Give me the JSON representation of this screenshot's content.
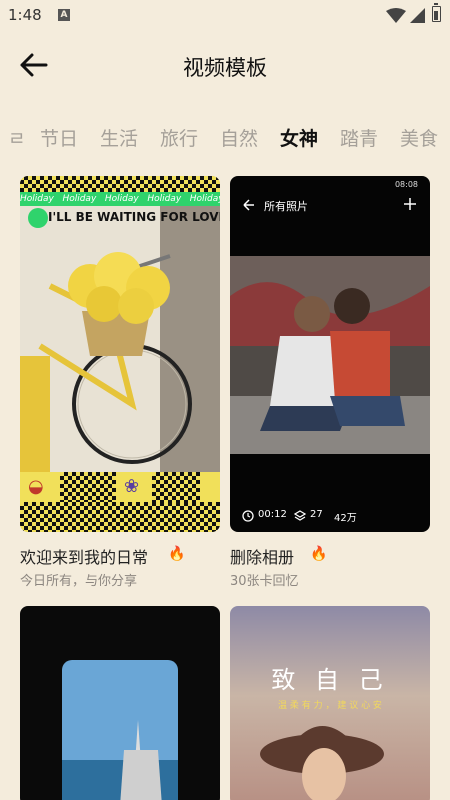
{
  "status": {
    "time": "1:48",
    "notif_icon": "A"
  },
  "header": {
    "title": "视频模板"
  },
  "tabs": [
    "节日",
    "生活",
    "旅行",
    "自然",
    "女神",
    "踏青",
    "美食"
  ],
  "active_tab": "女神",
  "cards": [
    {
      "title": "欢迎来到我的日常",
      "subtitle": "今日所有，与你分享",
      "overlay_banner": "Holiday",
      "overlay_text": "I'LL BE WAITING FOR LOVE"
    },
    {
      "title": "删除相册",
      "subtitle": "30张卡回忆",
      "phone_time": "08:08",
      "album_label": "所有照片",
      "duration": "00:12",
      "layers": "27",
      "views": "42万"
    },
    {
      "title": "",
      "subtitle": ""
    },
    {
      "title": "",
      "subtitle": "",
      "overlay_text": "致 自 己",
      "overlay_sub": "温 柔 有 力 ， 建 议 心 安"
    }
  ],
  "colors": {
    "background": "#f4ecdc",
    "active_tab": "#111111",
    "inactive_tab": "#a5a099",
    "hot_icon": "#f46d1a"
  },
  "icons": [
    "back-arrow-icon",
    "wifi-icon",
    "signal-icon",
    "battery-icon",
    "fire-icon",
    "clock-icon",
    "layers-icon",
    "plus-icon"
  ]
}
